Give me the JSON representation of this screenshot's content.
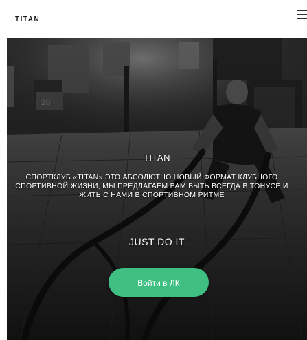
{
  "header": {
    "logo": "TITAN",
    "menu_icon": "hamburger-menu-icon"
  },
  "hero": {
    "title": "TITAN",
    "description": "Спортклуб «TITAN» это абсолютно новый формат клубного спортивной жизни, мы предлагаем вам быть всегда в тонусе и жить с нами в спортивном ритме",
    "slogan": "JUST DO IT",
    "button_label": "Войти в ЛК",
    "background_image": "gym-photo-man-with-battle-ropes"
  },
  "colors": {
    "button": "#3fbf82",
    "text_light": "#ffffff",
    "logo": "#1a1a1a"
  }
}
